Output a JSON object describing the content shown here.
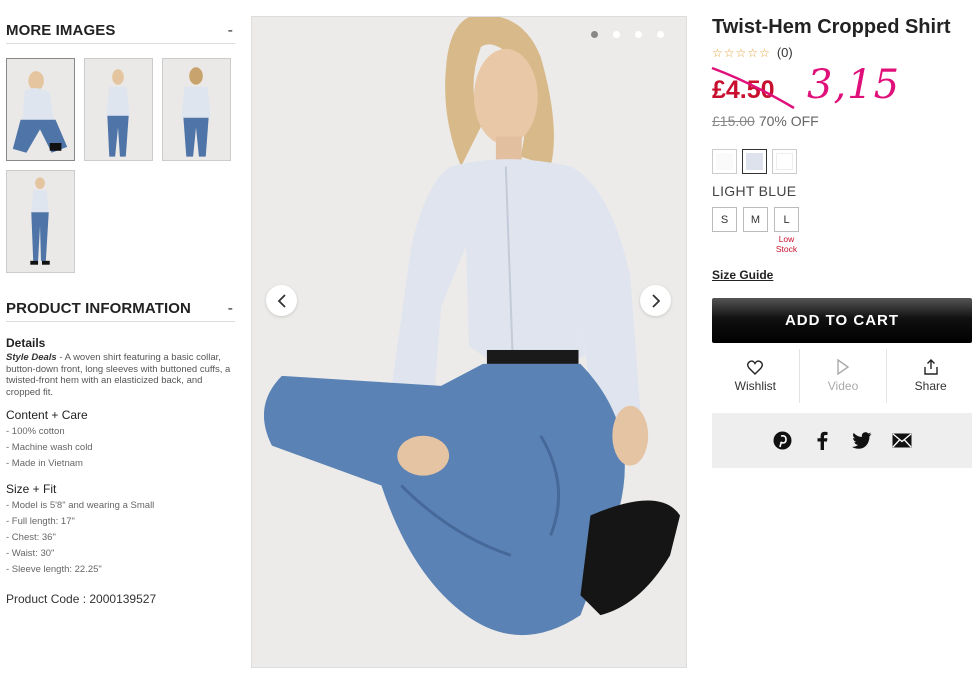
{
  "more_images": {
    "title": "MORE IMAGES",
    "toggle": "-"
  },
  "product_info": {
    "title": "PRODUCT INFORMATION",
    "toggle": "-",
    "details_title": "Details",
    "details_lead": "Style Deals",
    "details_text": " - A woven shirt featuring a basic collar, button-down front, long sleeves with buttoned cuffs, a twisted-front hem with an elasticized back, and cropped fit.",
    "content_title": "Content + Care",
    "content_items": [
      "- 100% cotton",
      "- Machine wash cold",
      "- Made in Vietnam"
    ],
    "size_title": "Size + Fit",
    "size_items": [
      "- Model is 5'8\" and wearing a Small",
      "- Full length: 17\"",
      "- Chest: 36\"",
      "- Waist: 30\"",
      "- Sleeve length: 22.25\""
    ],
    "code_label": "Product Code : 2000139527"
  },
  "product": {
    "title": "Twist-Hem Cropped Shirt",
    "rating_count": "(0)",
    "sale_price": "£4.50",
    "handwritten_price": "3,15",
    "original_price": "£15.00",
    "discount": "70% OFF",
    "color_name": "LIGHT BLUE",
    "swatch_colors": [
      "#fafafa",
      "#dde2ec",
      "#ffffff"
    ],
    "sizes": [
      "S",
      "M",
      "L"
    ],
    "low_stock_label": "Low Stock",
    "size_guide": "Size Guide",
    "add_to_cart": "ADD TO CART"
  },
  "actions": {
    "wishlist": "Wishlist",
    "video": "Video",
    "share": "Share"
  },
  "colors": {
    "sale": "#c8102e",
    "annotation": "#e0107a",
    "star": "#e2a23b"
  },
  "icons": [
    "heart-icon",
    "play-icon",
    "share-icon",
    "pinterest-icon",
    "facebook-icon",
    "twitter-icon",
    "email-icon",
    "chevron-left-icon",
    "chevron-right-icon"
  ]
}
